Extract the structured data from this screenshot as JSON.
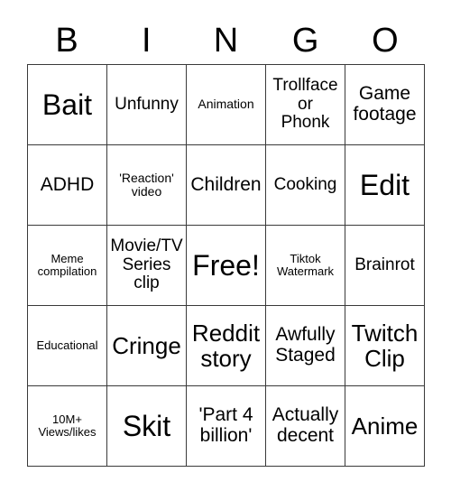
{
  "card": {
    "header_letters": [
      "B",
      "I",
      "N",
      "G",
      "O"
    ],
    "grid_size": "5x5",
    "border_color": "#3a3a3a",
    "background_color": "#ffffff",
    "text_color": "#000000",
    "rows": [
      [
        {
          "text": "Bait",
          "size": "xl"
        },
        {
          "text": "Unfunny",
          "size": "sm"
        },
        {
          "text": "Animation",
          "size": "xs"
        },
        {
          "text": "Trollface\nor\nPhonk",
          "size": "sm"
        },
        {
          "text": "Game\nfootage",
          "size": "md"
        }
      ],
      [
        {
          "text": "ADHD",
          "size": "md"
        },
        {
          "text": "'Reaction'\nvideo",
          "size": "xs"
        },
        {
          "text": "Children",
          "size": "md"
        },
        {
          "text": "Cooking",
          "size": "sm"
        },
        {
          "text": "Edit",
          "size": "xl"
        }
      ],
      [
        {
          "text": "Meme\ncompilation",
          "size": "xxs"
        },
        {
          "text": "Movie/TV\nSeries\nclip",
          "size": "sm"
        },
        {
          "text": "Free!",
          "size": "xl"
        },
        {
          "text": "Tiktok\nWatermark",
          "size": "xxs"
        },
        {
          "text": "Brainrot",
          "size": "sm"
        }
      ],
      [
        {
          "text": "Educational",
          "size": "xxs"
        },
        {
          "text": "Cringe",
          "size": "lg"
        },
        {
          "text": "Reddit\nstory",
          "size": "lg"
        },
        {
          "text": "Awfully\nStaged",
          "size": "md"
        },
        {
          "text": "Twitch\nClip",
          "size": "lg"
        }
      ],
      [
        {
          "text": "10M+\nViews/likes",
          "size": "xxs"
        },
        {
          "text": "Skit",
          "size": "xl"
        },
        {
          "text": "'Part 4\nbillion'",
          "size": "md"
        },
        {
          "text": "Actually\ndecent",
          "size": "md"
        },
        {
          "text": "Anime",
          "size": "lg"
        }
      ]
    ]
  }
}
